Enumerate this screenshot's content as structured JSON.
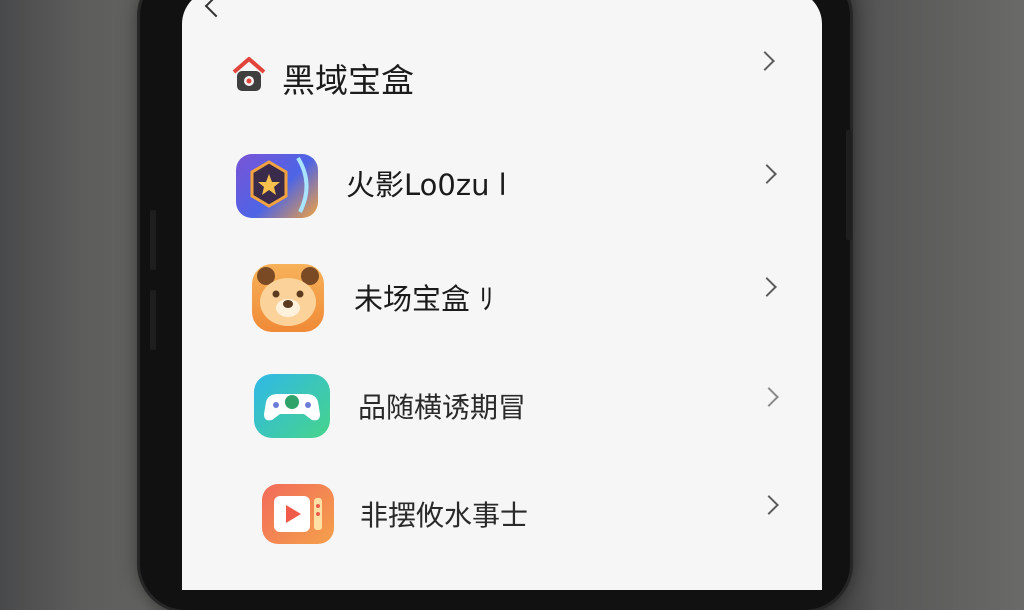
{
  "screen": {
    "back_icon": "chevron-left-icon",
    "items": [
      {
        "label": "黑域宝盒",
        "icon": "house-icon",
        "colors": {
          "accent": "#e0443a",
          "body": "#3f3f3f"
        }
      },
      {
        "label": "火影Lo0zu l",
        "icon": "star-badge-icon",
        "colors": {
          "from": "#7a54d6",
          "to": "#f2a23e"
        }
      },
      {
        "label": "未场宝盒 ﾘ",
        "icon": "bear-face-icon",
        "colors": {
          "from": "#f7b25a",
          "to": "#f08a36"
        }
      },
      {
        "label": "品随横诱期冒",
        "icon": "gamepad-icon",
        "colors": {
          "from": "#2fb8e8",
          "to": "#47d48a"
        }
      },
      {
        "label": "非摆攸水事士",
        "icon": "video-play-icon",
        "colors": {
          "from": "#f26b5a",
          "to": "#f4a14b"
        }
      }
    ],
    "chevron_icon": "chevron-right-icon"
  }
}
